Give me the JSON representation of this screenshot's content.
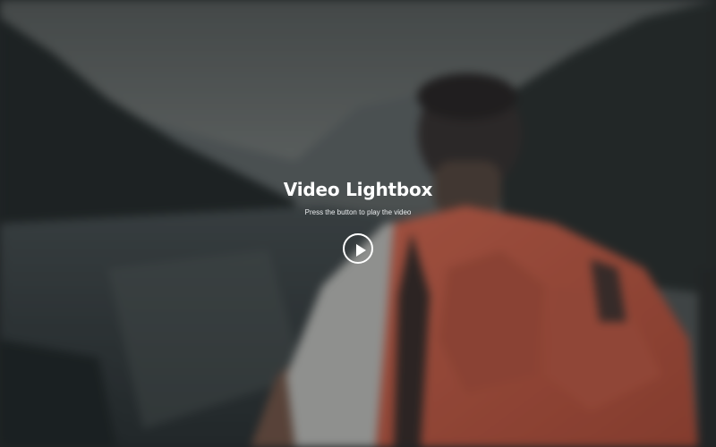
{
  "hero": {
    "title": "Video Lightbox",
    "subtitle": "Press the button to play the video",
    "play_icon": "play-icon",
    "accent_color": "#ffffff"
  },
  "background": {
    "description_icon": "hiker-backpack-lake-photo",
    "backpack_color": "#d4634d",
    "water_color": "#3b4347",
    "sky_color": "#6f7474"
  }
}
